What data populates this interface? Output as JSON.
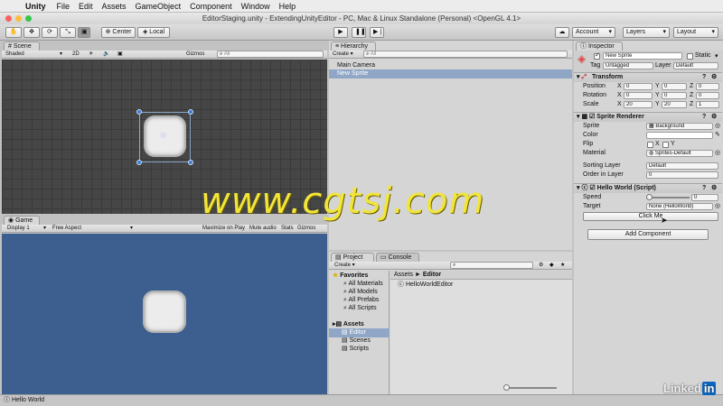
{
  "menubar": {
    "apple": "",
    "app": "Unity",
    "items": [
      "File",
      "Edit",
      "Assets",
      "GameObject",
      "Component",
      "Window",
      "Help"
    ]
  },
  "window_title": "EditorStaging.unity - ExtendingUnityEditor - PC, Mac & Linux Standalone (Personal) <OpenGL 4.1>",
  "toolbar": {
    "center": "Center",
    "local": "Local",
    "account": "Account",
    "layers": "Layers",
    "layout": "Layout"
  },
  "scene": {
    "tab": "Scene",
    "shading": "Shaded",
    "mode2d": "2D",
    "gizmos": "Gizmos",
    "search_placeholder": "All"
  },
  "game": {
    "tab": "Game",
    "display": "Display 1",
    "aspect": "Free Aspect",
    "maximize": "Maximize on Play",
    "mute": "Mute audio",
    "stats": "Stats",
    "gizmos": "Gizmos"
  },
  "hierarchy": {
    "tab": "Hierarchy",
    "create": "Create",
    "search_placeholder": "All",
    "items": [
      "Main Camera",
      "New Sprite"
    ]
  },
  "project": {
    "tab": "Project",
    "console_tab": "Console",
    "create": "Create",
    "favorites": "Favorites",
    "fav_items": [
      "All Materials",
      "All Models",
      "All Prefabs",
      "All Scripts"
    ],
    "assets": "Assets",
    "folders": [
      "Editor",
      "Scenes",
      "Scripts"
    ],
    "breadcrumb_root": "Assets",
    "breadcrumb_sep": "►",
    "breadcrumb_leaf": "Editor",
    "files": [
      "HelloWorldEditor"
    ]
  },
  "inspector": {
    "tab": "Inspector",
    "object_name": "New Sprite",
    "static": "Static",
    "tag_label": "Tag",
    "tag": "Untagged",
    "layer_label": "Layer",
    "layer": "Default",
    "transform": {
      "title": "Transform",
      "rows": [
        {
          "label": "Position",
          "x": "0",
          "y": "0",
          "z": "0"
        },
        {
          "label": "Rotation",
          "x": "0",
          "y": "0",
          "z": "0"
        },
        {
          "label": "Scale",
          "x": "20",
          "y": "20",
          "z": "1"
        }
      ]
    },
    "sprite_renderer": {
      "title": "Sprite Renderer",
      "sprite_label": "Sprite",
      "sprite": "Background",
      "color_label": "Color",
      "flip_label": "Flip",
      "flip_x": "X",
      "flip_y": "Y",
      "material_label": "Material",
      "material": "Sprites-Default",
      "sorting_label": "Sorting Layer",
      "sorting": "Default",
      "order_label": "Order in Layer",
      "order": "0"
    },
    "script": {
      "title": "Hello World (Script)",
      "speed_label": "Speed",
      "speed": "0",
      "target_label": "Target",
      "target": "None (HelloWorld)",
      "button": "Click Me"
    },
    "add_component": "Add Component"
  },
  "statusbar": {
    "message": "Hello World"
  },
  "watermark": "www.cgtsj.com",
  "brand": "Linked",
  "brand_in": "in",
  "colors": {
    "game_bg": "#3d5f8f",
    "scene_bg": "#464646",
    "selected": "#8fa6c7",
    "watermark": "#f2e53a"
  }
}
